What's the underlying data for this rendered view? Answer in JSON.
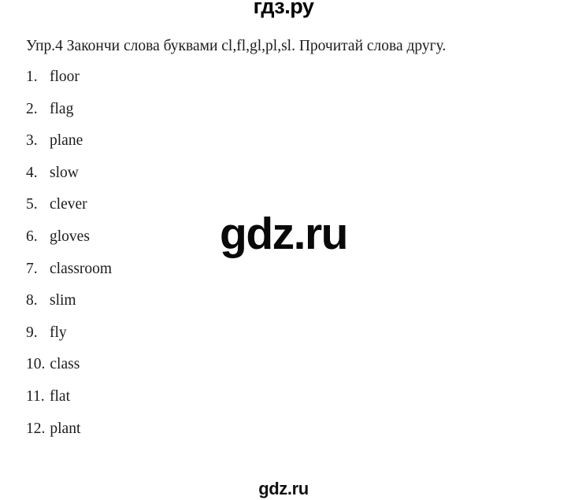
{
  "watermarks": {
    "top": "гдз.ру",
    "center": "gdz.ru",
    "bottom": "gdz.ru",
    "color": "#000000"
  },
  "exercise": {
    "instruction": "Упр.4 Закончи слова буквами cl,fl,gl,pl,sl. Прочитай слова другу.",
    "items": [
      {
        "num": "1.",
        "word": "floor"
      },
      {
        "num": "2.",
        "word": "flag"
      },
      {
        "num": "3.",
        "word": "plane"
      },
      {
        "num": "4.",
        "word": "slow"
      },
      {
        "num": "5.",
        "word": "clever"
      },
      {
        "num": "6.",
        "word": "gloves"
      },
      {
        "num": "7.",
        "word": "classroom"
      },
      {
        "num": "8.",
        "word": "slim"
      },
      {
        "num": "9.",
        "word": "fly"
      },
      {
        "num": "10.",
        "word": "class"
      },
      {
        "num": "11.",
        "word": "flat"
      },
      {
        "num": "12.",
        "word": "plant"
      }
    ]
  }
}
